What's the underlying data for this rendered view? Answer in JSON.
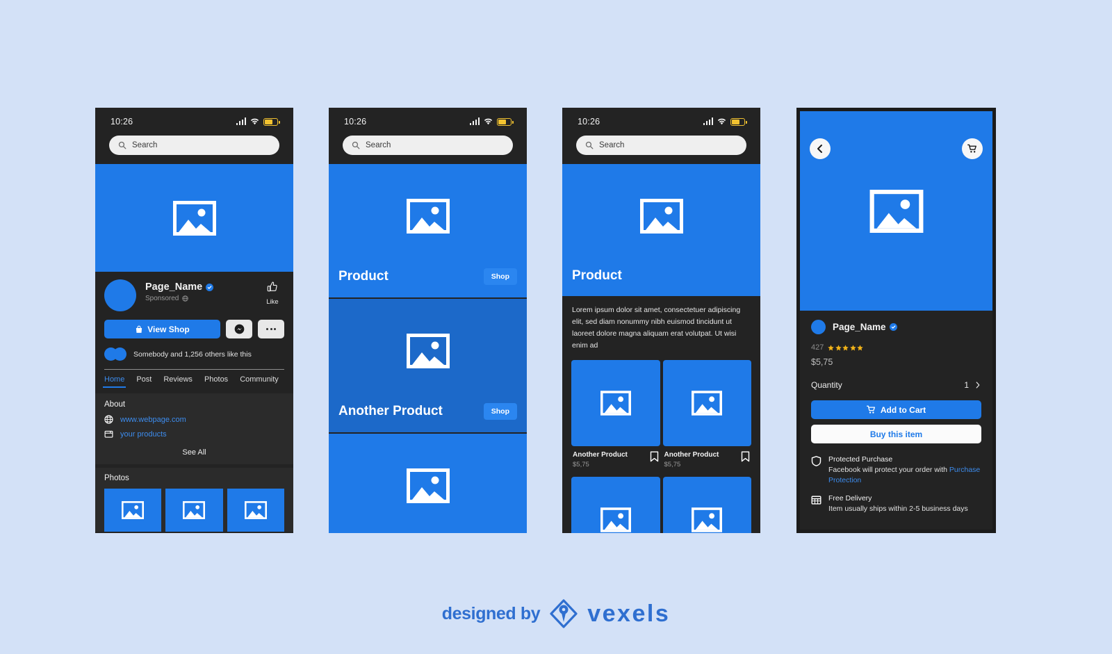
{
  "theme": {
    "page_bg": "#d3e1f7",
    "phone_bg": "#232323",
    "surface": "#2b2b2b",
    "accent_blue": "#1f7ae8",
    "accent_blue_dark": "#1c69c9",
    "link_blue": "#3d8ced",
    "star_yellow": "#f2b318",
    "battery_yellow": "#f2c230"
  },
  "status_bar": {
    "time": "10:26",
    "signal_icon": "signal-bars-icon",
    "wifi_icon": "wifi-icon",
    "battery_icon": "battery-icon"
  },
  "search": {
    "placeholder": "Search",
    "value": "Search",
    "icon": "search-icon"
  },
  "screen1": {
    "cover_image_icon": "image-placeholder-icon",
    "page_name": "Page_Name",
    "verified_icon": "verified-badge-icon",
    "sponsored_label": "Sponsored",
    "sponsored_icon": "globe-icon",
    "like": {
      "icon": "thumbs-up-icon",
      "label": "Like"
    },
    "view_shop": {
      "label": "View Shop",
      "icon": "shopping-bag-icon"
    },
    "messenger_icon": "messenger-icon",
    "more_icon": "more-dots-icon",
    "liked_by": "Somebody and 1,256 others like this",
    "tabs": [
      {
        "label": "Home",
        "active": true
      },
      {
        "label": "Post",
        "active": false
      },
      {
        "label": "Reviews",
        "active": false
      },
      {
        "label": "Photos",
        "active": false
      },
      {
        "label": "Community",
        "active": false
      }
    ],
    "about": {
      "title": "About",
      "links": [
        {
          "label": "www.webpage.com",
          "icon": "globe-icon"
        },
        {
          "label": "your products",
          "icon": "browser-window-icon"
        }
      ],
      "see_all": "See All"
    },
    "photos": {
      "title": "Photos",
      "count": 3,
      "thumb_icon": "image-placeholder-icon"
    }
  },
  "screen2": {
    "cards": [
      {
        "title": "Product",
        "button": "Shop",
        "shade": "light",
        "image_icon": "image-placeholder-icon"
      },
      {
        "title": "Another Product",
        "button": "Shop",
        "shade": "dark",
        "image_icon": "image-placeholder-icon"
      },
      {
        "title": "",
        "button": "",
        "shade": "light",
        "image_icon": "image-placeholder-icon"
      }
    ]
  },
  "screen3": {
    "hero_title": "Product",
    "hero_image_icon": "image-placeholder-icon",
    "description": "Lorem ipsum dolor sit amet, consectetuer adipiscing elit, sed diam nonummy nibh euismod tincidunt ut laoreet dolore magna aliquam erat volutpat. Ut wisi enim ad",
    "grid": [
      {
        "name": "Another Product",
        "price": "$5,75",
        "bookmark_icon": "bookmark-icon",
        "image_icon": "image-placeholder-icon"
      },
      {
        "name": "Another Product",
        "price": "$5,75",
        "bookmark_icon": "bookmark-icon",
        "image_icon": "image-placeholder-icon"
      },
      {
        "name": "",
        "price": "",
        "bookmark_icon": "bookmark-icon",
        "image_icon": "image-placeholder-icon"
      },
      {
        "name": "",
        "price": "",
        "bookmark_icon": "bookmark-icon",
        "image_icon": "image-placeholder-icon"
      }
    ]
  },
  "screen4": {
    "back_icon": "chevron-left-icon",
    "cart_icon": "shopping-cart-icon",
    "hero_image_icon": "image-placeholder-icon",
    "page_name": "Page_Name",
    "verified_icon": "verified-badge-icon",
    "rating_count": "427",
    "stars": 5,
    "price": "$5,75",
    "quantity_label": "Quantity",
    "quantity_value": "1",
    "quantity_chevron_icon": "chevron-right-icon",
    "add_to_cart": {
      "label": "Add to Cart",
      "icon": "shopping-cart-icon"
    },
    "buy_now": {
      "label": "Buy this item"
    },
    "info": [
      {
        "icon": "shield-icon",
        "title": "Protected Purchase",
        "desc_prefix": "Facebook will protect your order with ",
        "link": "Purchase Protection"
      },
      {
        "icon": "calendar-icon",
        "title": "Free Delivery",
        "desc_prefix": "Item usually ships within 2-5 business days",
        "link": ""
      }
    ]
  },
  "footer": {
    "designed_by": "designed by",
    "brand": "vexels",
    "logo_icon": "vexels-pen-logo-icon"
  }
}
